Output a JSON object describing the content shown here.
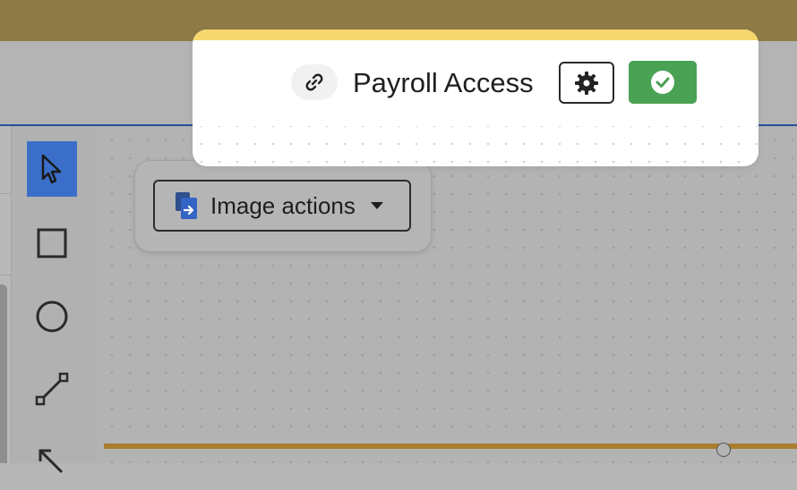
{
  "panel": {
    "title": "Payroll Access",
    "link_icon": "link-icon",
    "settings_icon": "gear-icon",
    "confirm_icon": "check-circle-icon",
    "accent_band_color": "#f5d76e",
    "confirm_color": "#4aa254"
  },
  "image_popup": {
    "button_label": "Image actions",
    "button_icon": "image-files-icon",
    "caret_icon": "caret-down-icon"
  },
  "toolbar": {
    "tools": [
      {
        "name": "select",
        "icon": "cursor-icon",
        "active": true
      },
      {
        "name": "rectangle",
        "icon": "square-icon",
        "active": false
      },
      {
        "name": "ellipse",
        "icon": "circle-icon",
        "active": false
      },
      {
        "name": "line",
        "icon": "line-icon",
        "active": false
      },
      {
        "name": "arrow",
        "icon": "arrow-icon",
        "active": false
      }
    ],
    "active_color": "#3b6ec8"
  },
  "colors": {
    "top_bar": "#8f7b45",
    "divider": "#2a4f9c"
  }
}
